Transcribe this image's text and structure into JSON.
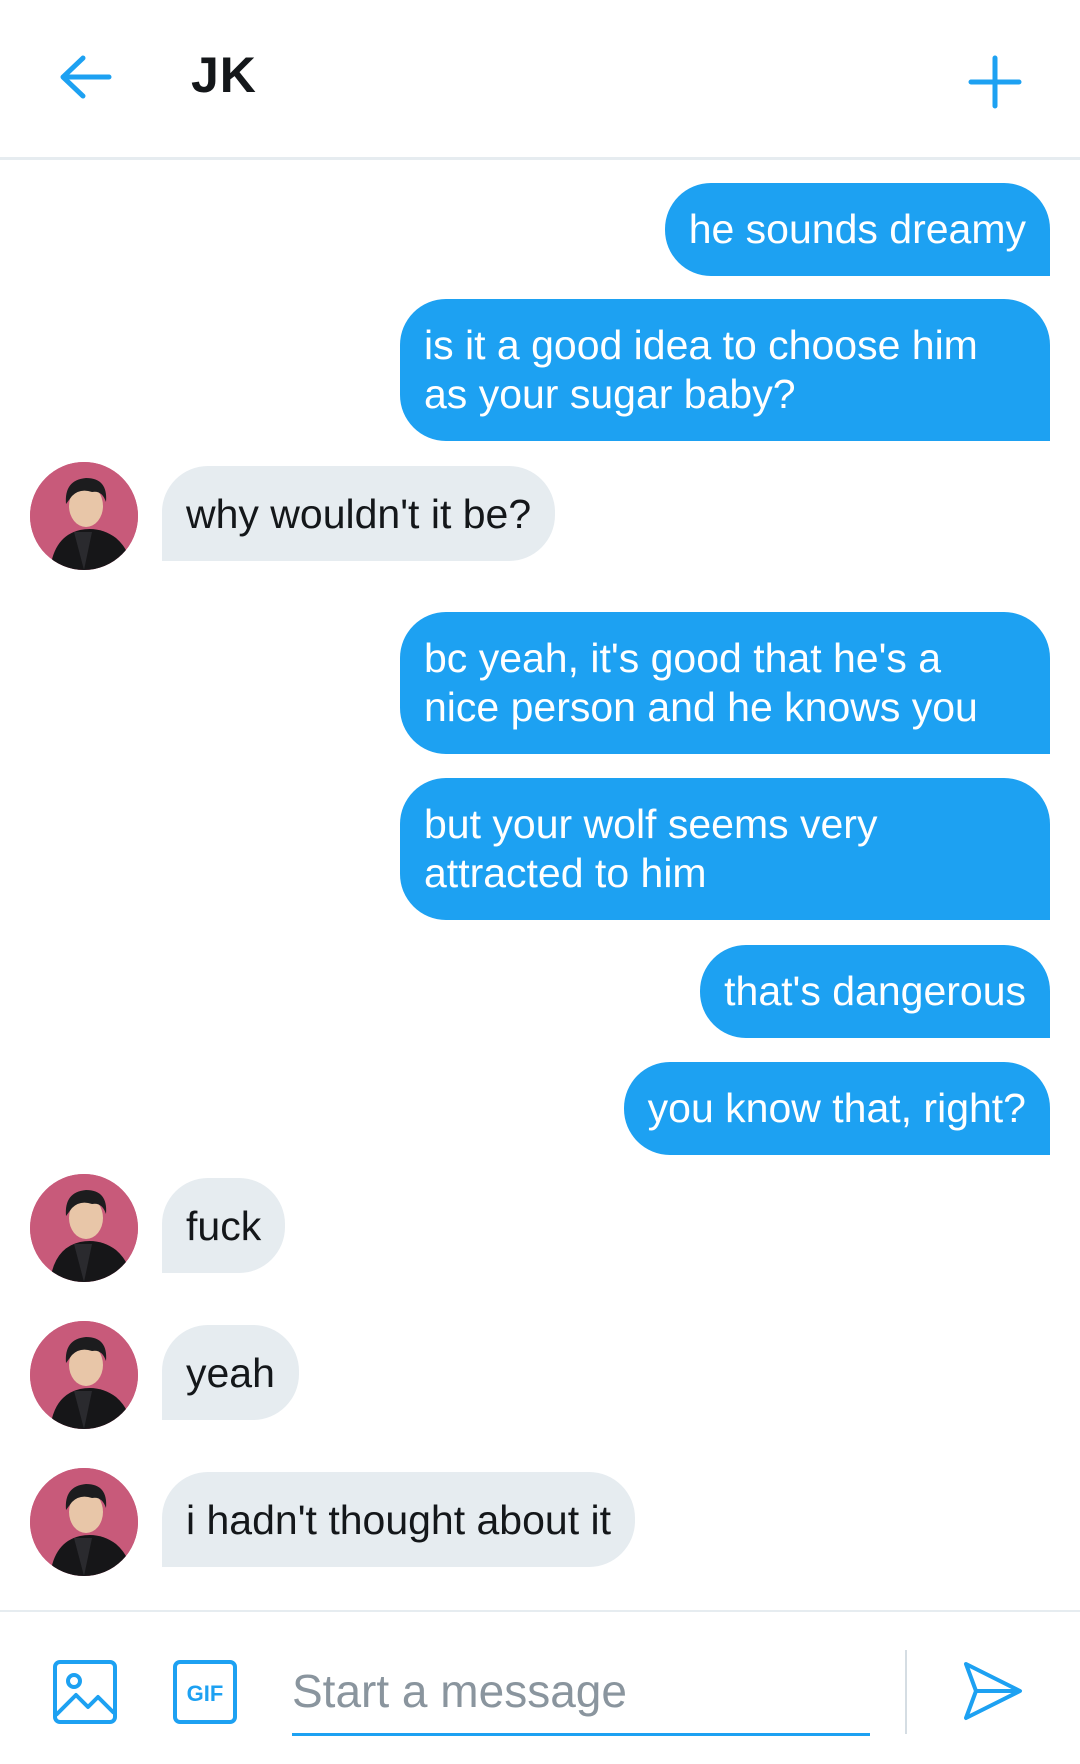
{
  "header": {
    "title": "JK",
    "back_icon": "arrow-left-icon",
    "new_icon": "plus-icon"
  },
  "messages": [
    {
      "side": "sent",
      "text": "he sounds dreamy"
    },
    {
      "side": "sent",
      "text": "is it a good idea to choose him as your sugar baby?"
    },
    {
      "side": "received",
      "text": "why wouldn't it be?"
    },
    {
      "side": "sent",
      "text": "bc yeah, it's good that he's a nice person and he knows you"
    },
    {
      "side": "sent",
      "text": "but your wolf seems very attracted to him"
    },
    {
      "side": "sent",
      "text": "that's dangerous"
    },
    {
      "side": "sent",
      "text": "you know that, right?"
    },
    {
      "side": "received",
      "text": "fuck"
    },
    {
      "side": "received",
      "text": "yeah"
    },
    {
      "side": "received",
      "text": "i hadn't thought about it"
    }
  ],
  "composer": {
    "placeholder": "Start a message",
    "value": "",
    "gif_label": "GIF"
  },
  "colors": {
    "accent": "#1da1f2",
    "received_bubble": "#e6ecf0",
    "text": "#14171a",
    "avatar_bg": "#c85a7a"
  }
}
